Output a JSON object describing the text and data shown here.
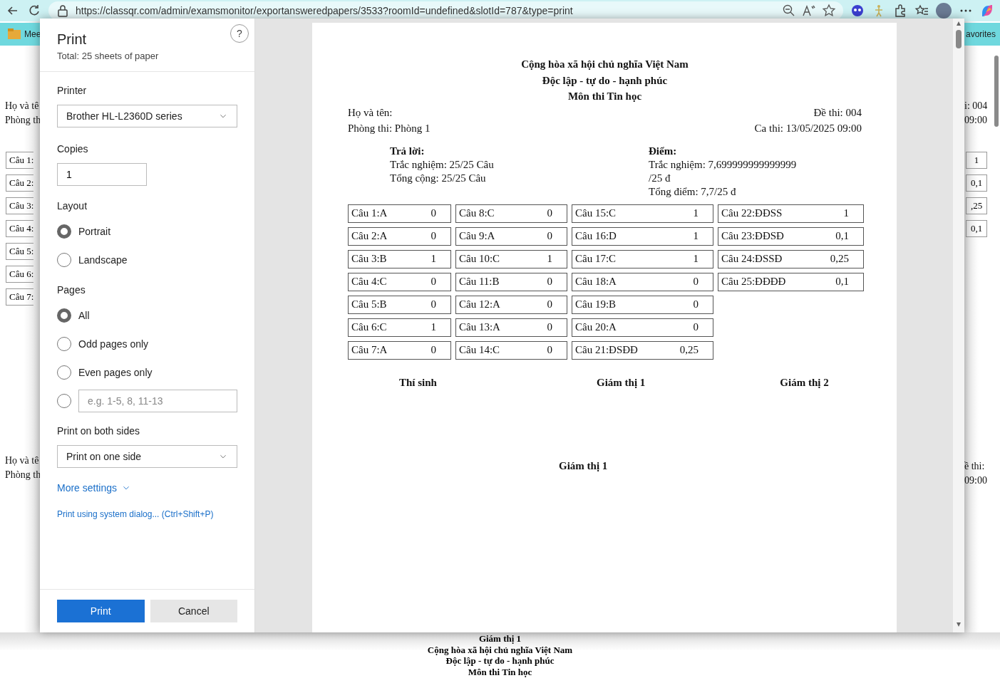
{
  "browser": {
    "url": "https://classqr.com/admin/examsmonitor/exportansweredpapers/3533?roomId=undefined&slotId=787&type=print",
    "favorites_left": "Mee",
    "favorites_right": "avorites"
  },
  "background_page": {
    "left": {
      "lines_top": [
        "Họ và tê",
        "Phòng th"
      ],
      "answers": [
        "Câu 1:",
        "Câu 2:",
        "Câu 3:",
        "Câu 4:",
        "Câu 5:",
        "Câu 6:",
        "Câu 7:"
      ],
      "lines_bottom": [
        "Họ và tê",
        "Phòng th"
      ]
    },
    "right": {
      "lines_top": [
        "i: 004",
        "09:00"
      ],
      "scores": [
        "1",
        "0,1",
        ",25",
        "0,1"
      ],
      "lines_bottom": [
        "ề thi:",
        "09:00"
      ]
    },
    "bottom": [
      "Giám thị 1",
      "Cộng hòa xã hội chủ nghĩa Việt Nam",
      "Độc lập - tự do - hạnh phúc",
      "Môn thi Tin học"
    ]
  },
  "print_dialog": {
    "title": "Print",
    "subtitle": "Total: 25 sheets of paper",
    "help": "?",
    "printer": {
      "label": "Printer",
      "value": "Brother HL-L2360D series"
    },
    "copies": {
      "label": "Copies",
      "value": "1"
    },
    "layout": {
      "label": "Layout",
      "options": [
        {
          "label": "Portrait",
          "selected": true
        },
        {
          "label": "Landscape",
          "selected": false
        }
      ]
    },
    "pages": {
      "label": "Pages",
      "options": [
        {
          "kind": "label",
          "label": "All",
          "selected": true
        },
        {
          "kind": "label",
          "label": "Odd pages only",
          "selected": false
        },
        {
          "kind": "label",
          "label": "Even pages only",
          "selected": false
        },
        {
          "kind": "custom",
          "placeholder": "e.g. 1-5, 8, 11-13",
          "selected": false
        }
      ]
    },
    "sides": {
      "label": "Print on both sides",
      "value": "Print on one side"
    },
    "more_settings": "More settings",
    "system_dialog": "Print using system dialog... (Ctrl+Shift+P)",
    "buttons": [
      {
        "label": "Print",
        "kind": "primary"
      },
      {
        "label": "Cancel",
        "kind": "secondary"
      }
    ]
  },
  "preview": {
    "headings": [
      "Cộng hòa xã hội chủ nghĩa Việt Nam",
      "Độc lập - tự do - hạnh phúc",
      "Môn thi Tin học"
    ],
    "info": [
      {
        "left": "Họ và tên:",
        "right": "Đề thi: 004"
      },
      {
        "left": "Phòng thi: Phòng 1",
        "right": "Ca thi: 13/05/2025 09:00"
      }
    ],
    "answered": {
      "title": "Trả lời:",
      "lines": [
        "Trắc nghiệm: 25/25 Câu",
        "Tổng cộng: 25/25 Câu"
      ]
    },
    "score": {
      "title": "Điểm:",
      "lines": [
        "Trắc nghiệm: 7,699999999999999",
        "/25 đ",
        "Tổng điểm: 7,7/25 đ"
      ]
    },
    "answer_columns": [
      [
        {
          "question": "Câu 1:A",
          "points": "0"
        },
        {
          "question": "Câu 2:A",
          "points": "0"
        },
        {
          "question": "Câu 3:B",
          "points": "1"
        },
        {
          "question": "Câu 4:C",
          "points": "0"
        },
        {
          "question": "Câu 5:B",
          "points": "0"
        },
        {
          "question": "Câu 6:C",
          "points": "1"
        },
        {
          "question": "Câu 7:A",
          "points": "0"
        }
      ],
      [
        {
          "question": "Câu 8:C",
          "points": "0"
        },
        {
          "question": "Câu 9:A",
          "points": "0"
        },
        {
          "question": "Câu 10:C",
          "points": "1"
        },
        {
          "question": "Câu 11:B",
          "points": "0"
        },
        {
          "question": "Câu 12:A",
          "points": "0"
        },
        {
          "question": "Câu 13:A",
          "points": "0"
        },
        {
          "question": "Câu 14:C",
          "points": "0"
        }
      ],
      [
        {
          "question": "Câu 15:C",
          "points": "1"
        },
        {
          "question": "Câu 16:D",
          "points": "1"
        },
        {
          "question": "Câu 17:C",
          "points": "1"
        },
        {
          "question": "Câu 18:A",
          "points": "0"
        },
        {
          "question": "Câu 19:B",
          "points": "0"
        },
        {
          "question": "Câu 20:A",
          "points": "0"
        },
        {
          "question": "Câu 21:ĐSĐĐ",
          "points": "0,25"
        }
      ],
      [
        {
          "question": "Câu 22:ĐĐSS",
          "points": "1"
        },
        {
          "question": "Câu 23:ĐĐSĐ",
          "points": "0,1"
        },
        {
          "question": "Câu 24:ĐSSĐ",
          "points": "0,25"
        },
        {
          "question": "Câu 25:ĐĐĐĐ",
          "points": "0,1"
        }
      ]
    ],
    "signatures": [
      "Thí sinh",
      "Giám thị 1",
      "Giám thị 2"
    ],
    "signature_below": "Giám thị 1"
  }
}
